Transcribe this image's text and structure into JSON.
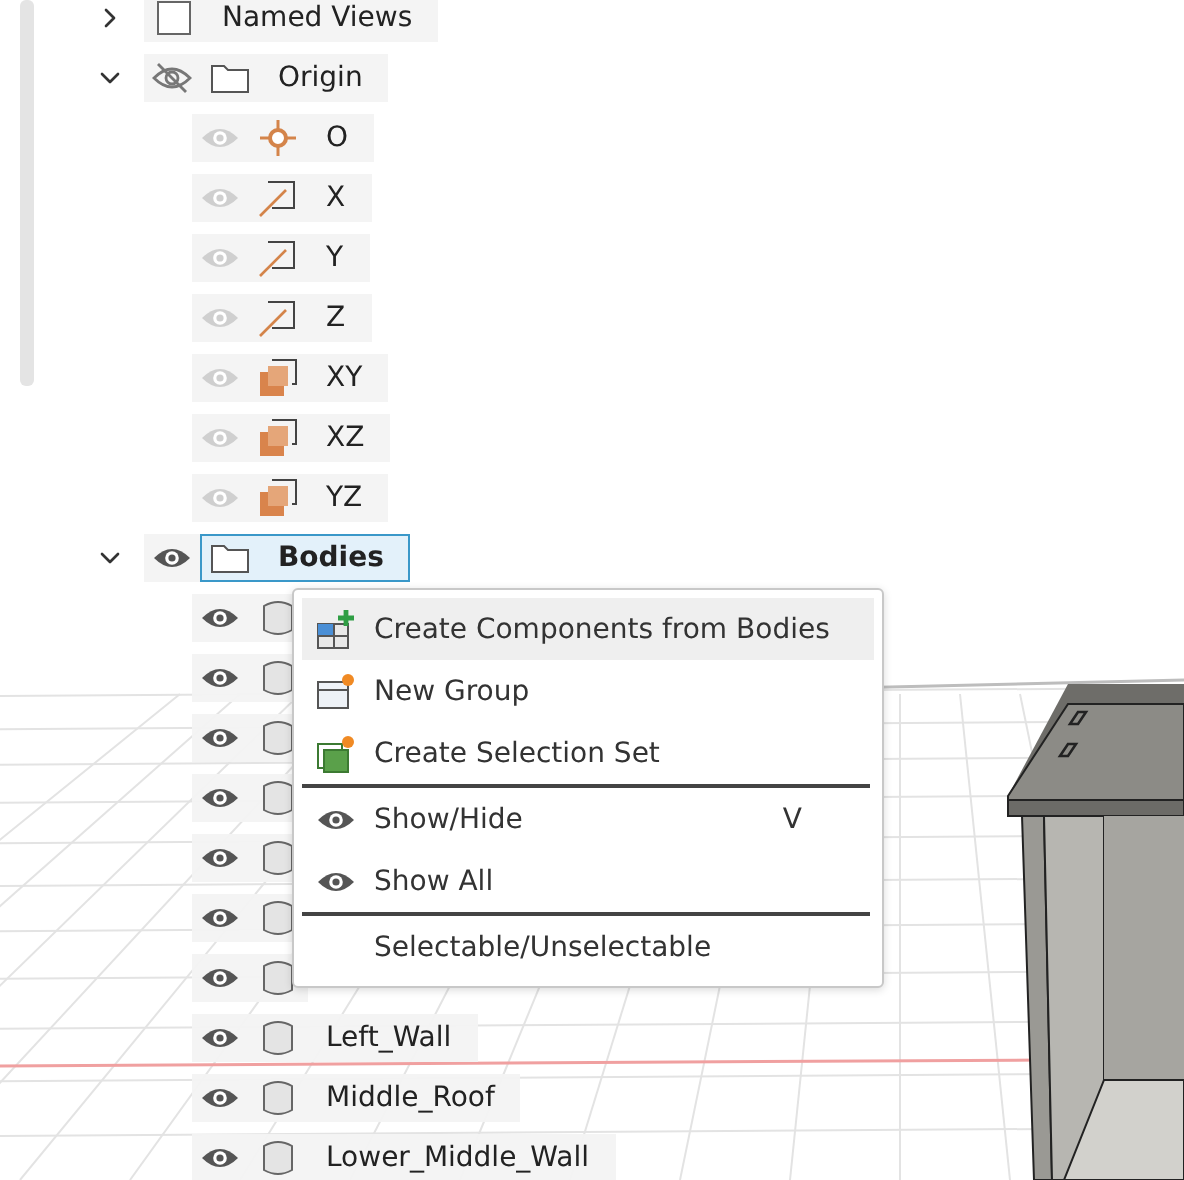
{
  "tree": [
    {
      "name": "Named Views",
      "kind": "views",
      "expanded": false,
      "selected": false
    },
    {
      "name": "Origin",
      "kind": "folder",
      "expanded": true,
      "visible": false,
      "selected": false,
      "children": [
        {
          "name": "O",
          "kind": "point",
          "visible": true,
          "selected": false
        },
        {
          "name": "X",
          "kind": "axis",
          "visible": true,
          "selected": false
        },
        {
          "name": "Y",
          "kind": "axis",
          "visible": true,
          "selected": false
        },
        {
          "name": "Z",
          "kind": "axis",
          "visible": true,
          "selected": false
        },
        {
          "name": "XY",
          "kind": "plane",
          "visible": true,
          "selected": false
        },
        {
          "name": "XZ",
          "kind": "plane",
          "visible": true,
          "selected": false
        },
        {
          "name": "YZ",
          "kind": "plane",
          "visible": true,
          "selected": false
        }
      ]
    },
    {
      "name": "Bodies",
      "kind": "folder",
      "expanded": true,
      "visible": true,
      "selected": true,
      "children": [
        {
          "kind": "body",
          "visible": true,
          "selected": false
        },
        {
          "kind": "body",
          "visible": true,
          "selected": false
        },
        {
          "kind": "body",
          "visible": true,
          "selected": false
        },
        {
          "kind": "body",
          "visible": true,
          "selected": false
        },
        {
          "kind": "body",
          "visible": true,
          "selected": false
        },
        {
          "kind": "body",
          "visible": true,
          "selected": false
        },
        {
          "kind": "body",
          "visible": true,
          "selected": false
        },
        {
          "name": "Left_Wall",
          "kind": "body",
          "visible": true,
          "selected": false
        },
        {
          "name": "Middle_Roof",
          "kind": "body",
          "visible": true,
          "selected": false
        },
        {
          "name": "Lower_Middle_Wall",
          "kind": "body",
          "visible": true,
          "selected": false
        }
      ]
    }
  ],
  "context_menu": [
    {
      "label": "Create Components from Bodies",
      "kind": "components",
      "highlighted": true,
      "separator_before": false
    },
    {
      "label": "New Group",
      "kind": "group",
      "highlighted": false,
      "separator_before": false
    },
    {
      "label": "Create Selection Set",
      "kind": "selection-set",
      "highlighted": false,
      "separator_before": false
    },
    {
      "label": "Show/Hide",
      "kind": "eye",
      "shortcut": "V",
      "highlighted": false,
      "separator_before": true
    },
    {
      "label": "Show All",
      "kind": "eye",
      "highlighted": false,
      "separator_before": false
    },
    {
      "label": "Selectable/Unselectable",
      "kind": "plain",
      "highlighted": false,
      "separator_before": true
    }
  ]
}
